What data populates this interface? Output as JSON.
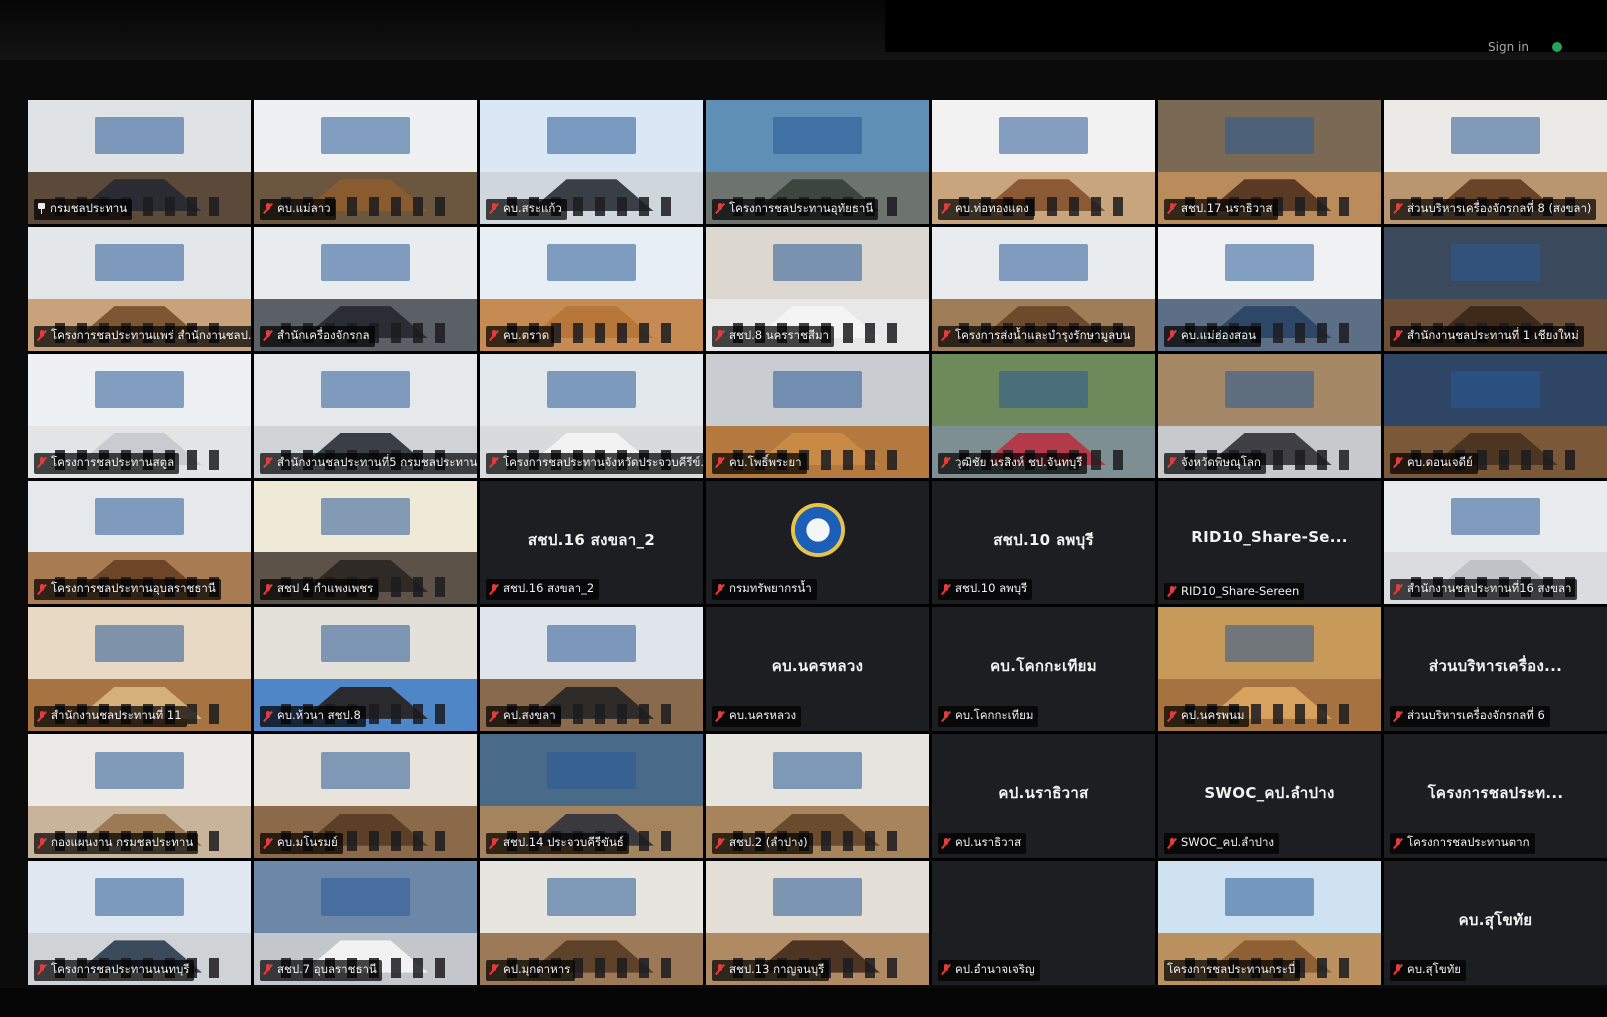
{
  "topbar": {
    "signin_label": "Sign in"
  },
  "colors": {
    "active_border": "#3ad15c",
    "mute_icon": "#e53b3b",
    "label_bg": "rgba(0,0,0,0.72)",
    "grid_bg": "#000000"
  },
  "tiles": [
    {
      "label": "กรมชลประทาน",
      "type": "video",
      "icon": "pin-icon",
      "wall": "#dfe3e6",
      "floor": "#5b4a3a",
      "table": "#2b2b33"
    },
    {
      "label": "คบ.แม่ลาว",
      "type": "video",
      "icon": "mute-icon",
      "wall": "#eef0f2",
      "floor": "#6b5640",
      "table": "#8a5b2e"
    },
    {
      "label": "คบ.สระแก้ว",
      "type": "video",
      "icon": "mute-icon",
      "wall": "#d9e8f4",
      "floor": "#cfd6dc",
      "table": "#3a3f46"
    },
    {
      "label": "โครงการชลประทานอุทัยธานี",
      "type": "video",
      "icon": "mute-icon",
      "wall": "#5f8fb5",
      "floor": "#6d7470",
      "table": "#3c463e"
    },
    {
      "label": "คบ.ท่อทองแดง",
      "type": "video",
      "icon": "mute-icon",
      "wall": "#f2f2f2",
      "floor": "#c9a57d",
      "table": "#8b5a34"
    },
    {
      "label": "สชป.17 นราธิวาส",
      "type": "video",
      "icon": "mute-icon",
      "wall": "#7a6a55",
      "floor": "#bb8c5b",
      "table": "#5a3a24"
    },
    {
      "label": "ส่วนบริหารเครื่องจักรกลที่ 8 (สงขลา)",
      "type": "video",
      "icon": "mute-icon",
      "wall": "#eceae6",
      "floor": "#b99670",
      "table": "#6a4428"
    },
    {
      "label": "โครงการชลประทานแพร่ สำนักงานชลป...",
      "type": "video",
      "icon": "mute-icon",
      "wall": "#e4e7ea",
      "floor": "#c7a27a",
      "table": "#7d5633"
    },
    {
      "label": "สำนักเครื่องจักรกล",
      "type": "video",
      "icon": "mute-icon",
      "wall": "#e8ecef",
      "floor": "#5b5f66",
      "table": "#2a2e34"
    },
    {
      "label": "คบ.ตราด",
      "type": "video",
      "icon": "mute-icon",
      "wall": "#e7eef4",
      "floor": "#c58b52",
      "table": "#b7763a"
    },
    {
      "label": "สชป.8 นครราชสีมา",
      "type": "video",
      "icon": "mute-icon",
      "wall": "#dcd7cf",
      "floor": "#e8e8e8",
      "table": "#f4f4f4"
    },
    {
      "label": "โครงการส่งน้ำและบำรุงรักษามูลบน",
      "type": "video",
      "icon": "mute-icon",
      "wall": "#e9ecef",
      "floor": "#a07d59",
      "table": "#6e4a2c"
    },
    {
      "label": "คบ.แม่ฮ่องสอน",
      "type": "video",
      "icon": "mute-icon",
      "wall": "#f0f1f3",
      "floor": "#5d6f86",
      "table": "#2f4766"
    },
    {
      "label": "สำนักงานชลประทานที่ 1 เชียงใหม่",
      "type": "video",
      "icon": "mute-icon",
      "wall": "#3a4a5c",
      "floor": "#6a4e36",
      "table": "#3d2a1b"
    },
    {
      "label": "โครงการชลประทานสตูล",
      "type": "video",
      "icon": "mute-icon",
      "wall": "#eef1f3",
      "floor": "#e2e4e6",
      "table": "#c8cbcf"
    },
    {
      "label": "สำนักงานชลประทานที่5 กรมชลประทาน",
      "type": "video",
      "icon": "mute-icon",
      "wall": "#e6e9ec",
      "floor": "#cfd3d6",
      "table": "#3a3f46"
    },
    {
      "label": "โครงการชลประทานจังหวัดประจวบคีรีข์...",
      "type": "video",
      "icon": "mute-icon",
      "wall": "#e3e8ec",
      "floor": "#d8dadc",
      "table": "#f2f2f2"
    },
    {
      "label": "คบ.โพธิ์พระยา",
      "type": "video",
      "icon": "mute-icon",
      "wall": "#c9ccd0",
      "floor": "#b3793f",
      "table": "#c98a45"
    },
    {
      "label": "วุฒิชัย นรสิงห์ ชป.จันทบุรี",
      "type": "video",
      "icon": "mute-icon",
      "wall": "#6f8a5a",
      "floor": "#7d8f92",
      "table": "#b33a48"
    },
    {
      "label": "จังหวัดพิษณุโลก",
      "type": "video",
      "icon": "mute-icon",
      "wall": "#a58966",
      "floor": "#c7c9cc",
      "table": "#3f3f45"
    },
    {
      "label": "คบ.ดอนเจดีย์",
      "type": "video",
      "icon": "mute-icon",
      "wall": "#2e4566",
      "floor": "#7a5838",
      "table": "#4c3521"
    },
    {
      "label": "โครงการชลประทานอุบลราชธานี",
      "type": "video",
      "icon": "mute-icon",
      "wall": "#e6e9ec",
      "floor": "#a87b52",
      "table": "#6d4527"
    },
    {
      "label": "สชป 4 กำแพงเพชร",
      "type": "video",
      "icon": "mute-icon",
      "wall": "#efe9d8",
      "floor": "#5c5248",
      "table": "#2f2a26"
    },
    {
      "label": "สชป.16 สงขลา_2",
      "type": "name",
      "center": "สชป.16 สงขลา_2",
      "icon": "mute-icon"
    },
    {
      "label": "กรมทรัพยากรน้ำ",
      "type": "logo",
      "icon": "mute-icon"
    },
    {
      "label": "สชป.10 ลพบุรี",
      "type": "name",
      "center": "สชป.10 ลพบุรี",
      "icon": "mute-icon"
    },
    {
      "label": "RID10_Share-Sereen",
      "type": "name",
      "center": "RID10_Share-Se...",
      "icon": "mute-icon"
    },
    {
      "label": "สำนักงานชลประทานที่16 สงขลา",
      "type": "video",
      "icon": "mute-icon",
      "wall": "#e9ecef",
      "floor": "#dadcdf",
      "table": "#bfc3c8"
    },
    {
      "label": "สำนักงานชลประทานที่ 11",
      "type": "video",
      "icon": "mute-icon",
      "wall": "#e7d9c4",
      "floor": "#a77441",
      "table": "#d6b07a"
    },
    {
      "label": "คบ.ห้วนา สชป.8",
      "type": "video",
      "icon": "mute-icon",
      "wall": "#e4e1da",
      "floor": "#4f86c7",
      "table": "#2a2a2e"
    },
    {
      "label": "คป.สงขลา",
      "type": "video",
      "icon": "mute-icon",
      "wall": "#dfe5ea",
      "floor": "#8a6a4c",
      "table": "#2f2b28"
    },
    {
      "label": "คบ.นครหลวง",
      "type": "name",
      "center": "คบ.นครหลวง",
      "icon": "mute-icon"
    },
    {
      "label": "คบ.โคกกะเทียม",
      "type": "name",
      "center": "คบ.โคกกะเทียม",
      "icon": "mute-icon"
    },
    {
      "label": "คป.นครพนม",
      "type": "video",
      "icon": "mute-icon",
      "wall": "#c79a5a",
      "floor": "#a6723f",
      "table": "#d7a25e"
    },
    {
      "label": "ส่วนบริหารเครื่องจักรกลที่ 6",
      "type": "name",
      "center": "ส่วนบริหารเครื่อง...",
      "icon": "mute-icon"
    },
    {
      "label": "กองแผนงาน กรมชลประทาน",
      "type": "video",
      "icon": "mute-icon",
      "wall": "#eceae6",
      "floor": "#c7b49a",
      "table": "#9b7a55"
    },
    {
      "label": "คบ.มโนรมย์",
      "type": "video",
      "icon": "mute-icon",
      "wall": "#e8e4dc",
      "floor": "#8b6a49",
      "table": "#5b3f27"
    },
    {
      "label": "สชป.14 ประจวบคีรีขันธ์",
      "type": "video",
      "icon": "mute-icon",
      "wall": "#4a6a8a",
      "floor": "#a4835f",
      "table": "#3a3a3e"
    },
    {
      "label": "สชป.2 (ลำปาง)",
      "type": "video",
      "icon": "mute-icon",
      "wall": "#e6e4df",
      "floor": "#a8845c",
      "table": "#6b4b2e"
    },
    {
      "label": "คป.นราธิวาส",
      "type": "name",
      "center": "คป.นราธิวาส",
      "icon": "mute-icon"
    },
    {
      "label": "SWOC_คป.ลำปาง",
      "type": "name",
      "center": "SWOC_คป.ลำปาง",
      "icon": "mute-icon"
    },
    {
      "label": "โครงการชลประทานตาก",
      "type": "name",
      "center": "โครงการชลประท...",
      "icon": "mute-icon"
    },
    {
      "label": "โครงการชลประทานนนทบุรี",
      "type": "video",
      "icon": "mute-icon",
      "wall": "#dfe8f0",
      "floor": "#cfd3d6",
      "table": "#3a4a5a"
    },
    {
      "label": "สชป.7 อุบลราชธานี",
      "type": "video",
      "icon": "mute-icon",
      "active": true,
      "wall": "#6d87a8",
      "floor": "#c3c6ca",
      "table": "#f2f2f2"
    },
    {
      "label": "คป.มุกดาหาร",
      "type": "video",
      "icon": "mute-icon",
      "wall": "#e7e5e0",
      "floor": "#9c7a57",
      "table": "#5e4129"
    },
    {
      "label": "สชป.13 กาญจนบุรี",
      "type": "video",
      "icon": "mute-icon",
      "wall": "#e3ded6",
      "floor": "#b08a63",
      "table": "#4d3423"
    },
    {
      "label": "คป.อำนาจเจริญ",
      "type": "dark",
      "icon": "mute-icon"
    },
    {
      "label": "โครงการชลประทานกระบี่",
      "type": "video",
      "icon": "none",
      "wall": "#cfe2f2",
      "floor": "#bb915f",
      "table": "#8f6033"
    },
    {
      "label": "คบ.สุโขทัย",
      "type": "name",
      "center": "คบ.สุโขทัย",
      "icon": "mute-icon"
    }
  ]
}
